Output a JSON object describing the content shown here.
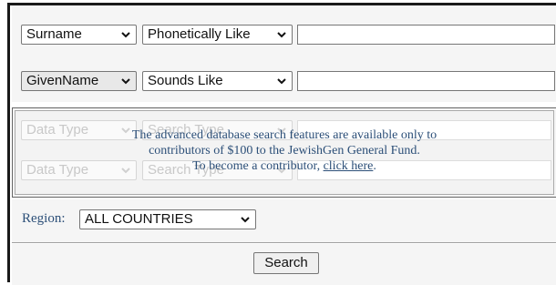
{
  "search_rows": [
    {
      "field": "Surname",
      "match": "Phonetically Like",
      "value": ""
    },
    {
      "field": "GivenName",
      "match": "Sounds Like",
      "value": ""
    }
  ],
  "advanced": {
    "rows": [
      {
        "field": "Data Type",
        "match": "Search Type"
      },
      {
        "field": "Data Type",
        "match": "Search Type"
      }
    ],
    "notice_line1": "The advanced database search features are available only to",
    "notice_line2": "contributors of $100 to the JewishGen General Fund.",
    "notice_line3_prefix": "To become a contributor,",
    "notice_link": "click here",
    "notice_line3_suffix": "."
  },
  "region": {
    "label": "Region:",
    "value": "ALL COUNTRIES"
  },
  "search_button": "Search",
  "icons": {
    "dropdown": "chevron-down-icon"
  },
  "colors": {
    "notice_text": "#2c4f78",
    "panel_bg": "#f5f5f5"
  }
}
